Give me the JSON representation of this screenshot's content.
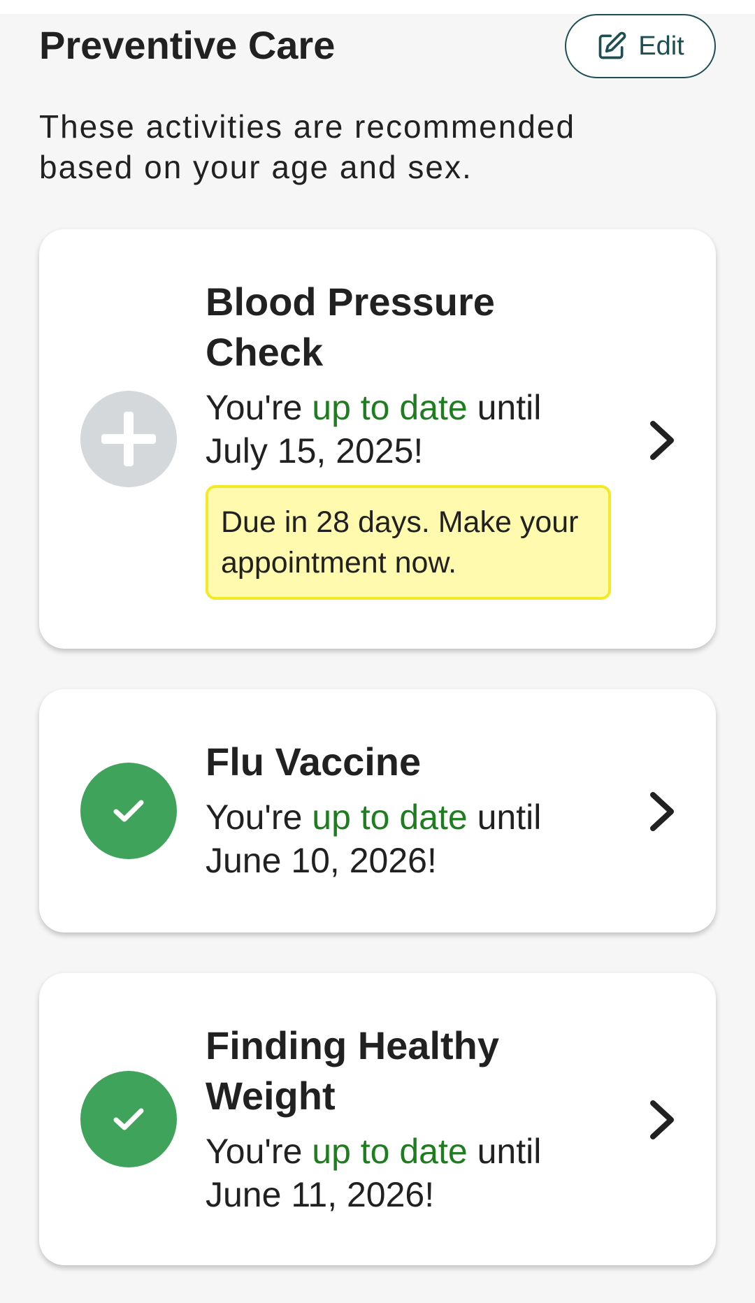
{
  "header": {
    "title": "Preventive Care",
    "edit_label": "Edit"
  },
  "intro_text": "These activities are recommended based on your age and sex.",
  "cards": [
    {
      "title": "Blood Pressure Check",
      "status_icon": "plus-icon",
      "status_prefix": "You're ",
      "status_highlight": "up to date",
      "status_suffix": " until July 15, 2025!",
      "due_notice": "Due in 28 days. Make your appointment now."
    },
    {
      "title": "Flu Vaccine",
      "status_icon": "check-icon",
      "status_prefix": "You're ",
      "status_highlight": "up to date",
      "status_suffix": " until June 10, 2026!"
    },
    {
      "title": "Finding Healthy Weight",
      "status_icon": "check-icon",
      "status_prefix": "You're ",
      "status_highlight": "up to date",
      "status_suffix": " until June 11, 2026!"
    }
  ],
  "colors": {
    "accent_green": "#1e7d1e",
    "check_circle": "#3fa35b",
    "plus_circle": "#d5d8db",
    "due_background": "#fffaae",
    "due_border": "#f3e927",
    "edit_border": "#1f4e52"
  }
}
